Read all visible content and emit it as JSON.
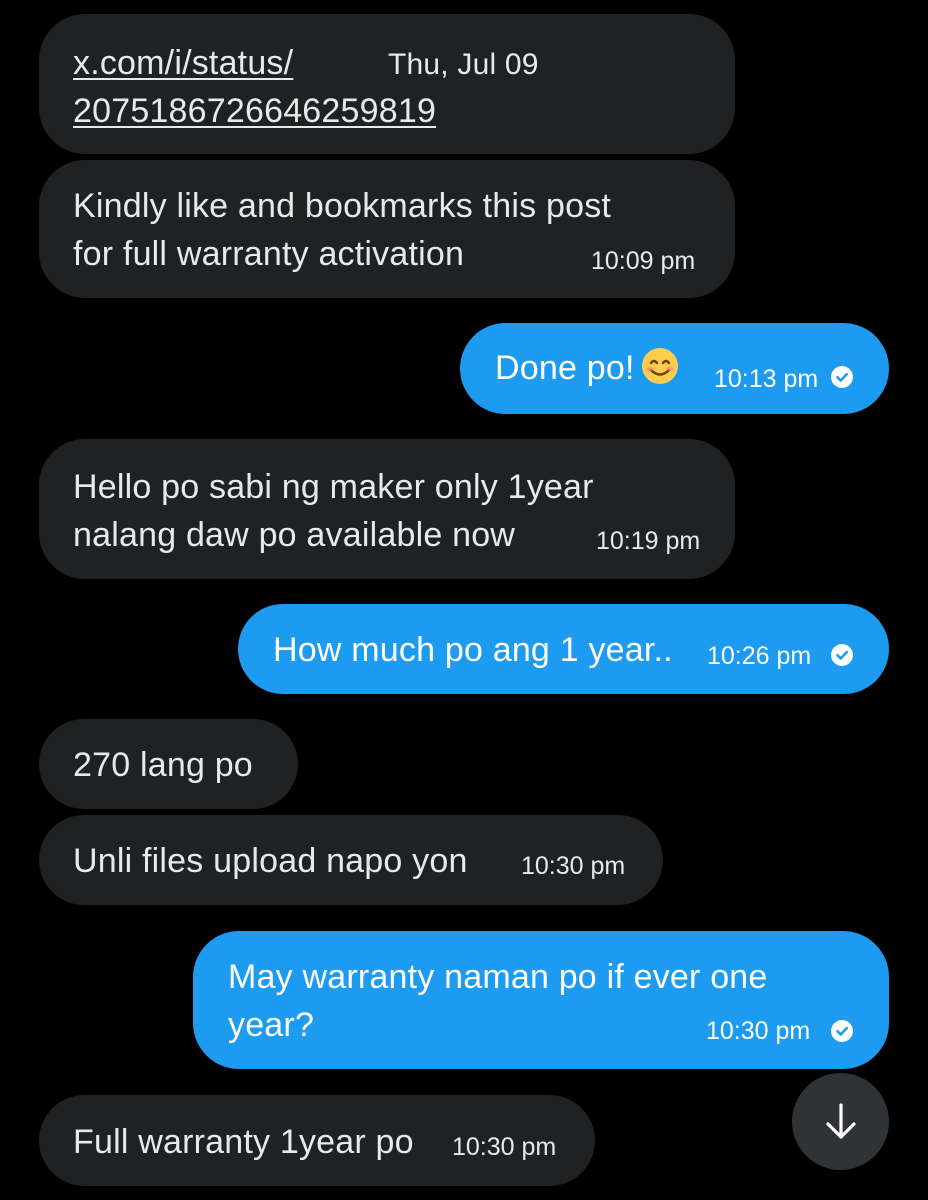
{
  "messages": [
    {
      "side": "in",
      "link_line1": "x.com/i/status/",
      "link_line2": "2075186726646259819",
      "date": "Thu, Jul 09"
    },
    {
      "side": "in",
      "line1": "Kindly like and bookmarks this post",
      "line2": "for full warranty activation",
      "time": "10:09 pm"
    },
    {
      "side": "out",
      "text": "Done po!",
      "emoji": "smiling-face-icon",
      "time": "10:13 pm"
    },
    {
      "side": "in",
      "line1": "Hello po sabi ng maker only 1year",
      "line2": "nalang daw po available now",
      "time": "10:19 pm"
    },
    {
      "side": "out",
      "text": "How much po ang 1 year..",
      "time": "10:26 pm"
    },
    {
      "side": "in",
      "text": "270 lang po"
    },
    {
      "side": "in",
      "text": "Unli files upload napo yon",
      "time": "10:30 pm"
    },
    {
      "side": "out",
      "line1": "May warranty naman po if ever one",
      "line2": "year?",
      "time": "10:30 pm"
    },
    {
      "side": "in",
      "text": "Full warranty 1year po",
      "time": "10:30 pm"
    }
  ],
  "scroll_button": {
    "icon": "arrow-down-icon"
  },
  "colors": {
    "background": "#000000",
    "incoming_bubble": "#202123",
    "outgoing_bubble": "#1d9bf0",
    "text": "#e7e9ea"
  }
}
